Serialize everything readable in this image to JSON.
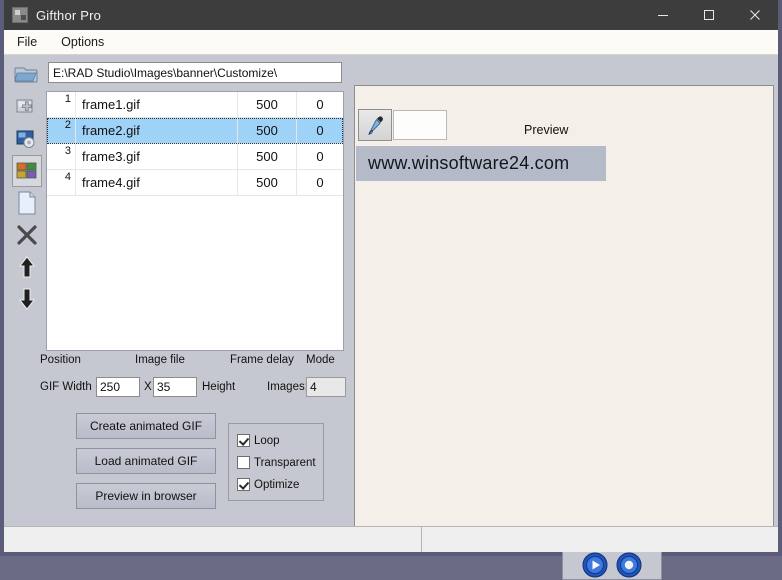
{
  "window": {
    "title": "Gifthor Pro",
    "icon": "app-icon",
    "controls": {
      "minimize": "–",
      "maximize": "□",
      "close": "✕"
    }
  },
  "menu": {
    "items": [
      "File",
      "Options"
    ]
  },
  "toolbar_path": {
    "folder_icon": "open-folder-icon",
    "path_value": "E:\\RAD Studio\\Images\\banner\\Customize\\"
  },
  "left_toolbar": {
    "items": [
      {
        "name": "open-folder-icon",
        "tooltip": "Open folder"
      },
      {
        "name": "add-image-icon",
        "tooltip": "Add image"
      },
      {
        "name": "image-effects-icon",
        "tooltip": "Image effects"
      },
      {
        "name": "thumbnails-grid-icon",
        "tooltip": "Thumbnails",
        "pressed": true
      },
      {
        "name": "new-page-icon",
        "tooltip": "New"
      },
      {
        "name": "delete-x-icon",
        "tooltip": "Delete"
      },
      {
        "name": "move-up-arrow-icon",
        "tooltip": "Move up"
      },
      {
        "name": "move-down-arrow-icon",
        "tooltip": "Move down"
      }
    ]
  },
  "frame_list": {
    "column_labels": [
      "Position",
      "Image file",
      "Frame delay",
      "Mode"
    ],
    "rows": [
      {
        "position": "1",
        "file": "frame1.gif",
        "delay": "500",
        "mode": "0",
        "selected": false
      },
      {
        "position": "2",
        "file": "frame2.gif",
        "delay": "500",
        "mode": "0",
        "selected": true
      },
      {
        "position": "3",
        "file": "frame3.gif",
        "delay": "500",
        "mode": "0",
        "selected": false
      },
      {
        "position": "4",
        "file": "frame4.gif",
        "delay": "500",
        "mode": "0",
        "selected": false
      }
    ]
  },
  "size_row": {
    "gif_width_label": "GIF Width",
    "width_value": "250",
    "x_label": "X",
    "height_value": "35",
    "height_label": "Height",
    "images_label": "Images:",
    "images_value": "4"
  },
  "actions": {
    "create": "Create animated GIF",
    "load": "Load animated GIF",
    "preview": "Preview in browser"
  },
  "options": {
    "loop": {
      "label": "Loop",
      "checked": true
    },
    "transparent": {
      "label": "Transparent",
      "checked": false
    },
    "optimize": {
      "label": "Optimize",
      "checked": true
    }
  },
  "preview": {
    "eyedropper_icon": "eyedropper-icon",
    "swatch_color": "#fdfdfb",
    "label": "Preview",
    "banner_text": "www.winsoftware24.com",
    "banner_bg": "#b5bac8",
    "panel_bg": "#f4efe8"
  },
  "playback": {
    "play_icon": "play-circle-icon",
    "stop_icon": "stop-circle-icon"
  },
  "statusbar": {
    "panel1": "",
    "panel2": ""
  }
}
